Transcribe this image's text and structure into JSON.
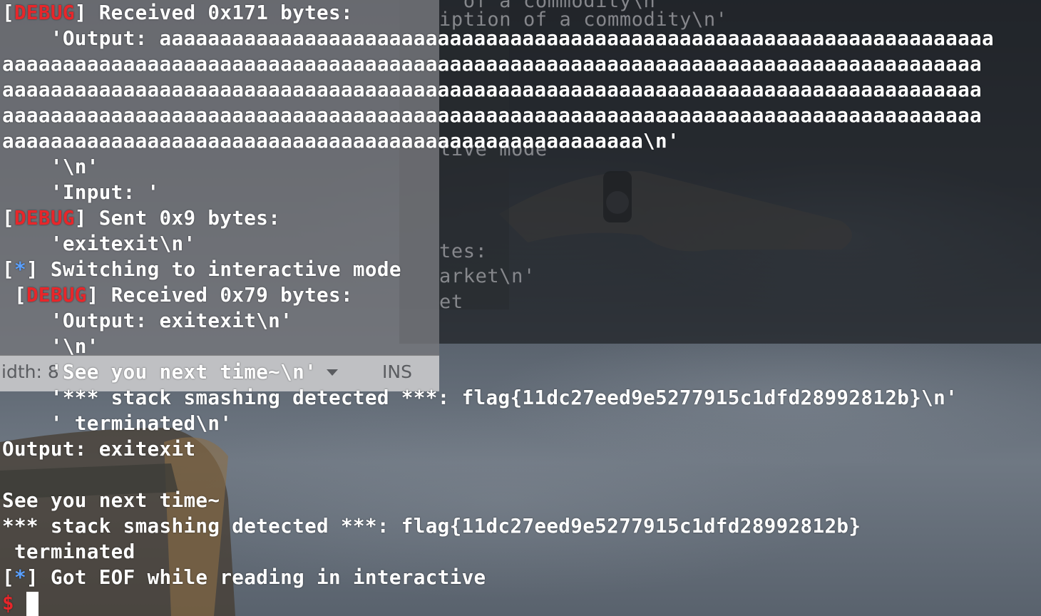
{
  "background_editor": {
    "lines": [
      "  of a commodity\\n",
      "iption of a commodity\\n'",
      "tive mode",
      "tes:",
      "arket\\n'",
      "et"
    ]
  },
  "overlay_statusbar": {
    "width_label": "idth: 8",
    "mode_label": "INS"
  },
  "terminal": {
    "l1": {
      "open": "[",
      "tag": "DEBUG",
      "rest": "] Received 0x171 bytes:"
    },
    "l2": "    'Output: aaaaaaaaaaaaaaaaaaaaaaaaaaaaaaaaaaaaaaaaaaaaaaaaaaaaaaaaaaaaaaaaaaaaa",
    "l3": "aaaaaaaaaaaaaaaaaaaaaaaaaaaaaaaaaaaaaaaaaaaaaaaaaaaaaaaaaaaaaaaaaaaaaaaaaaaaaaaaa",
    "l4": "aaaaaaaaaaaaaaaaaaaaaaaaaaaaaaaaaaaaaaaaaaaaaaaaaaaaaaaaaaaaaaaaaaaaaaaaaaaaaaaaa",
    "l5": "aaaaaaaaaaaaaaaaaaaaaaaaaaaaaaaaaaaaaaaaaaaaaaaaaaaaaaaaaaaaaaaaaaaaaaaaaaaaaaaaa",
    "l6": "aaaaaaaaaaaaaaaaaaaaaaaaaaaaaaaaaaaaaaaaaaaaaaaaaaaaa\\n'",
    "l7": "    '\\n'",
    "l8": "    'Input: '",
    "l9": {
      "open": "[",
      "tag": "DEBUG",
      "rest": "] Sent 0x9 bytes:"
    },
    "l10": "    'exitexit\\n'",
    "l11": {
      "open": "[",
      "tag": "*",
      "rest": "] Switching to interactive mode"
    },
    "l12": {
      "open": " [",
      "tag": "DEBUG",
      "rest": "] Received 0x79 bytes:"
    },
    "l13": "    'Output: exitexit\\n'",
    "l14": "    '\\n'",
    "l15": "    'See you next time~\\n'",
    "l16": "    '*** stack smashing detected ***: flag{11dc27eed9e5277915c1dfd28992812b}\\n'",
    "l17": "    ' terminated\\n'",
    "l18": "Output: exitexit",
    "l19": "",
    "l20": "See you next time~",
    "l21": "*** stack smashing detected ***: flag{11dc27eed9e5277915c1dfd28992812b}",
    "l22": " terminated",
    "l23": {
      "open": "[",
      "tag": "*",
      "rest": "] Got EOF while reading in interactive"
    },
    "prompt": "$ "
  },
  "colors": {
    "debug_tag": "#e8262a",
    "info_tag": "#5aa0ff",
    "prompt": "#e8262a",
    "text": "#ffffff"
  }
}
